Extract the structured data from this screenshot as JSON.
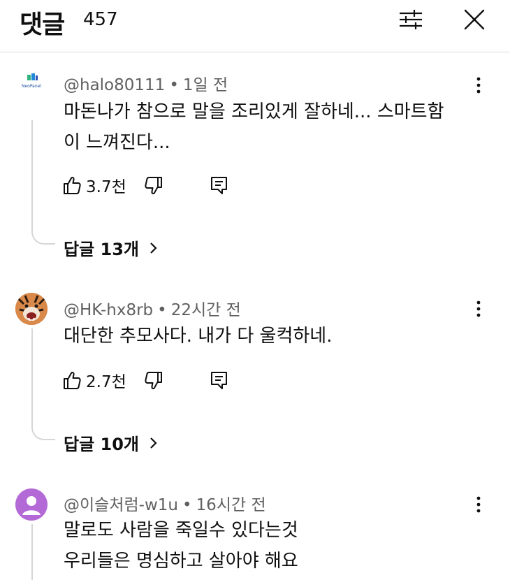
{
  "header": {
    "title": "댓글",
    "count": "457",
    "filter_icon": "sliders-icon",
    "close_icon": "close-icon"
  },
  "comments": [
    {
      "author": "@halo80111",
      "time": "1일 전",
      "text_lines": [
        "마돈나가 참으로 말을 조리있게 잘하네... 스마트함",
        "이 느껴진다..."
      ],
      "likes": "3.7천",
      "replies": "답글 13개",
      "avatar": "NeoPanel",
      "avatar_icon": "neopanel-logo"
    },
    {
      "author": "@HK-hx8rb",
      "time": "22시간 전",
      "text_lines": [
        "대단한 추모사다. 내가 다 울컥하네."
      ],
      "likes": "2.7천",
      "replies": "답글 10개",
      "avatar_icon": "tiger-avatar"
    },
    {
      "author": "@이슬처럼-w1u",
      "time": "16시간 전",
      "text_lines": [
        "말로도 사람을 죽일수 있다는것",
        "우리들은 명심하고 살아야 해요"
      ],
      "avatar_icon": "default-user-avatar",
      "avatar_color": "#b46ad6"
    }
  ],
  "icons": {
    "like": "thumbs-up-icon",
    "dislike": "thumbs-down-icon",
    "reply": "reply-icon",
    "more": "more-vert-icon",
    "chevron": "chevron-right-icon"
  }
}
